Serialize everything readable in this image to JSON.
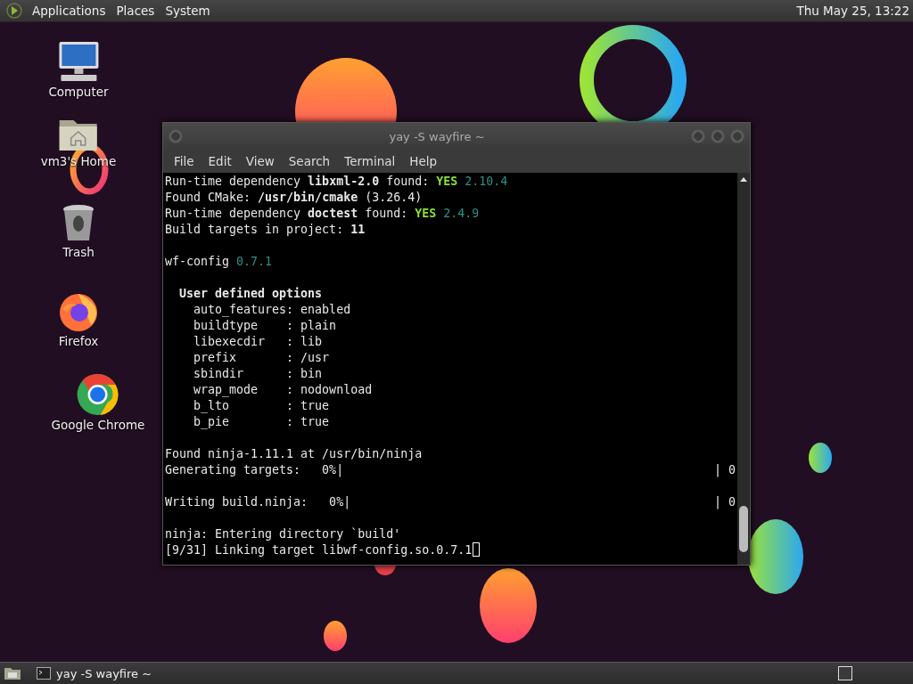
{
  "top_panel": {
    "menus": [
      "Applications",
      "Places",
      "System"
    ],
    "clock": "Thu May 25, 13:22"
  },
  "desktop_icons": [
    {
      "kind": "computer",
      "label": "Computer"
    },
    {
      "kind": "home",
      "label": "vm3's Home"
    },
    {
      "kind": "trash",
      "label": "Trash"
    },
    {
      "kind": "firefox",
      "label": "Firefox"
    },
    {
      "kind": "chrome",
      "label": "Google Chrome"
    }
  ],
  "terminal": {
    "title": "yay -S wayfire ~",
    "menu": [
      "File",
      "Edit",
      "View",
      "Search",
      "Terminal",
      "Help"
    ],
    "lines": [
      {
        "kind": "text",
        "segments": [
          {
            "kind": "plain",
            "text": "Run-time dependency "
          },
          {
            "kind": "bold",
            "text": "libxml-2.0"
          },
          {
            "kind": "plain",
            "text": " found: "
          },
          {
            "kind": "green",
            "text": "YES"
          },
          {
            "kind": "teal",
            "text": " 2.10.4"
          }
        ]
      },
      {
        "kind": "text",
        "segments": [
          {
            "kind": "plain",
            "text": "Found CMake: "
          },
          {
            "kind": "bold",
            "text": "/usr/bin/cmake"
          },
          {
            "kind": "plain",
            "text": " (3.26.4)"
          }
        ]
      },
      {
        "kind": "text",
        "segments": [
          {
            "kind": "plain",
            "text": "Run-time dependency "
          },
          {
            "kind": "bold",
            "text": "doctest"
          },
          {
            "kind": "plain",
            "text": " found: "
          },
          {
            "kind": "green",
            "text": "YES"
          },
          {
            "kind": "teal",
            "text": " 2.4.9"
          }
        ]
      },
      {
        "kind": "text",
        "segments": [
          {
            "kind": "plain",
            "text": "Build targets in project: "
          },
          {
            "kind": "bold",
            "text": "11"
          }
        ]
      },
      {
        "kind": "blank"
      },
      {
        "kind": "text",
        "segments": [
          {
            "kind": "plain",
            "text": "wf-config "
          },
          {
            "kind": "teal",
            "text": "0.7.1"
          }
        ]
      },
      {
        "kind": "blank"
      },
      {
        "kind": "text",
        "segments": [
          {
            "kind": "bold",
            "text": "  User defined options"
          }
        ]
      },
      {
        "kind": "text",
        "segments": [
          {
            "kind": "plain",
            "text": "    auto_features: enabled"
          }
        ]
      },
      {
        "kind": "text",
        "segments": [
          {
            "kind": "plain",
            "text": "    buildtype    : plain"
          }
        ]
      },
      {
        "kind": "text",
        "segments": [
          {
            "kind": "plain",
            "text": "    libexecdir   : lib"
          }
        ]
      },
      {
        "kind": "text",
        "segments": [
          {
            "kind": "plain",
            "text": "    prefix       : /usr"
          }
        ]
      },
      {
        "kind": "text",
        "segments": [
          {
            "kind": "plain",
            "text": "    sbindir      : bin"
          }
        ]
      },
      {
        "kind": "text",
        "segments": [
          {
            "kind": "plain",
            "text": "    wrap_mode    : nodownload"
          }
        ]
      },
      {
        "kind": "text",
        "segments": [
          {
            "kind": "plain",
            "text": "    b_lto        : true"
          }
        ]
      },
      {
        "kind": "text",
        "segments": [
          {
            "kind": "plain",
            "text": "    b_pie        : true"
          }
        ]
      },
      {
        "kind": "blank"
      },
      {
        "kind": "text",
        "segments": [
          {
            "kind": "plain",
            "text": "Found ninja-1.11.1 at /usr/bin/ninja"
          }
        ]
      },
      {
        "kind": "progress",
        "left": "Generating targets:   0%|",
        "right": "| 0"
      },
      {
        "kind": "blank"
      },
      {
        "kind": "progress",
        "left": "Writing build.ninja:   0%|",
        "right": "| 0"
      },
      {
        "kind": "blank"
      },
      {
        "kind": "text",
        "segments": [
          {
            "kind": "plain",
            "text": "ninja: Entering directory `build'"
          }
        ]
      },
      {
        "kind": "prompt",
        "segments": [
          {
            "kind": "plain",
            "text": "[9/31] Linking target libwf-config.so.0.7.1"
          }
        ]
      }
    ]
  },
  "taskbar": {
    "tasks": [
      {
        "label": "yay -S wayfire ~",
        "selected": false
      }
    ]
  }
}
